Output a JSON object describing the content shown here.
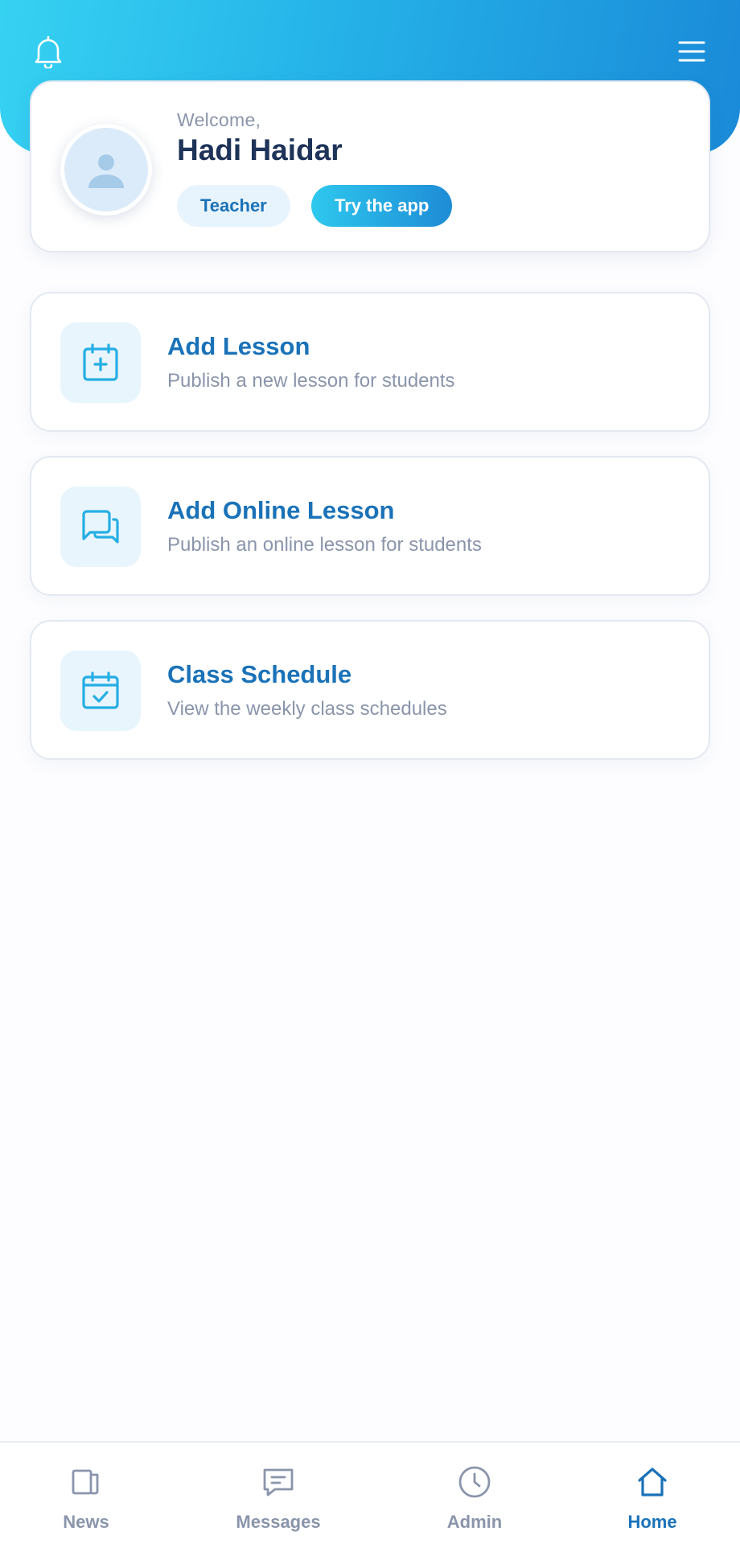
{
  "header": {
    "bell_icon": "bell-icon",
    "menu_icon": "hamburger-menu-icon"
  },
  "welcome": {
    "greeting": "Welcome,",
    "name": "Hadi Haidar",
    "role": "Teacher",
    "cta": "Try the app",
    "avatar_icon": "user-avatar-icon"
  },
  "actions": [
    {
      "title": "Add Lesson",
      "description": "Publish a new lesson for students",
      "icon": "calendar-plus-icon"
    },
    {
      "title": "Add Online Lesson",
      "description": "Publish an online lesson for students",
      "icon": "chat-bubbles-icon"
    },
    {
      "title": "Class Schedule",
      "description": "View the weekly class schedules",
      "icon": "calendar-check-icon"
    }
  ],
  "nav": {
    "items": [
      {
        "label": "News",
        "icon": "news-icon",
        "active": false
      },
      {
        "label": "Messages",
        "icon": "message-icon",
        "active": false
      },
      {
        "label": "Admin",
        "icon": "clock-icon",
        "active": false
      },
      {
        "label": "Home",
        "icon": "home-icon",
        "active": true
      }
    ]
  },
  "colors": {
    "accent": "#1a72b8",
    "header_gradient_start": "#36d2f2",
    "header_gradient_end": "#1a8ad8",
    "muted_text": "#8a95ab",
    "name_text": "#1e3358"
  }
}
